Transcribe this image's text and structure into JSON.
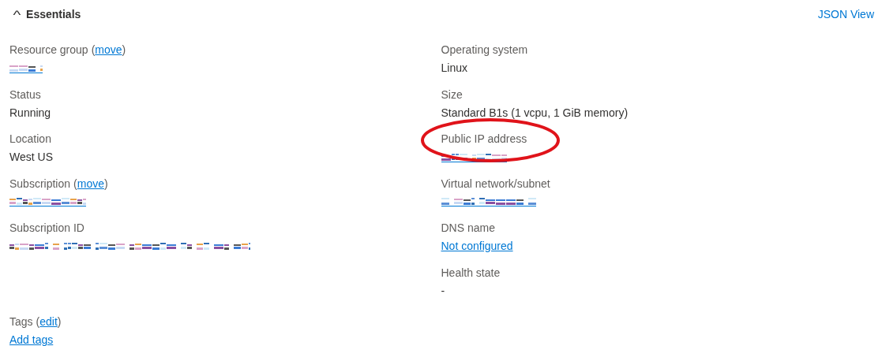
{
  "header": {
    "chevron": "^",
    "title": "Essentials",
    "expanded": true,
    "json_view": "JSON View"
  },
  "left": [
    {
      "label": "Resource group",
      "action": {
        "open": "(",
        "text": "move",
        "close": ")"
      },
      "kind": "redacted_link"
    },
    {
      "label": "Status",
      "kind": "text",
      "value": "Running"
    },
    {
      "label": "Location",
      "kind": "text",
      "value": "West US"
    },
    {
      "label": "Subscription",
      "action": {
        "open": "(",
        "text": "move",
        "close": ")"
      },
      "kind": "redacted_link"
    },
    {
      "label": "Subscription ID",
      "kind": "redacted"
    }
  ],
  "right": [
    {
      "label": "Operating system",
      "kind": "text",
      "value": "Linux"
    },
    {
      "label": "Size",
      "kind": "text",
      "value": "Standard B1s (1 vcpu, 1 GiB memory)"
    },
    {
      "label": "Public IP address",
      "kind": "redacted_link",
      "circled": true
    },
    {
      "label": "Virtual network/subnet",
      "kind": "redacted_link"
    },
    {
      "label": "DNS name",
      "kind": "link",
      "value": "Not configured"
    },
    {
      "label": "Health state",
      "kind": "text",
      "value": "-"
    }
  ],
  "tags": {
    "label": "Tags",
    "action": {
      "open": "(",
      "text": "edit",
      "close": ")"
    },
    "value": "Add tags"
  }
}
